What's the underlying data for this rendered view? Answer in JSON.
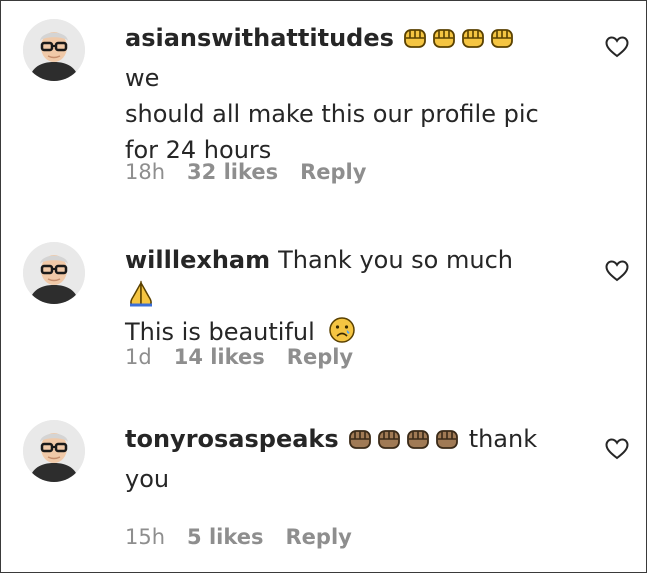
{
  "comments": [
    {
      "username": "asianswithattitudes",
      "text_line1": "we",
      "text_line2": "should all make this our profile pic",
      "text_line3": "for 24 hours",
      "time": "18h",
      "likes": "32 likes",
      "reply": "Reply",
      "emoji_color": "#f5c542"
    },
    {
      "username": "willlexham",
      "text_line1": "Thank you so much",
      "text_line2": "This is beautiful",
      "time": "1d",
      "likes": "14 likes",
      "reply": "Reply"
    },
    {
      "username": "tonyrosaspeaks",
      "text_line1": "thank",
      "text_line2": "you",
      "time": "15h",
      "likes": "5 likes",
      "reply": "Reply",
      "emoji_color": "#a07a55"
    }
  ]
}
